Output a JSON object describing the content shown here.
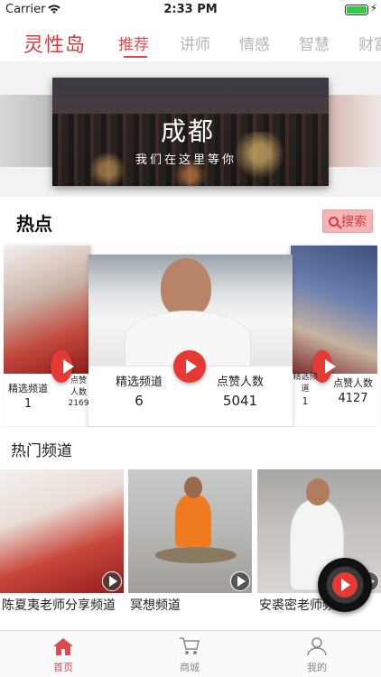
{
  "status_bar": {
    "carrier": "Carrier",
    "time": "2:33 PM"
  },
  "app": {
    "logo": "灵性岛"
  },
  "top_tabs": [
    {
      "label": "推荐",
      "active": true
    },
    {
      "label": "讲师",
      "active": false
    },
    {
      "label": "情感",
      "active": false
    },
    {
      "label": "智慧",
      "active": false
    },
    {
      "label": "财富",
      "active": false
    }
  ],
  "banner": {
    "title": "成都",
    "slogan": "我们在这里等你"
  },
  "hot": {
    "title": "热点",
    "search_label": "搜索",
    "cards": [
      {
        "left_label": "精选频道",
        "left_value": "1",
        "right_label": "点赞人数",
        "right_value": "2169"
      },
      {
        "left_label": "精选频道",
        "left_value": "6",
        "right_label": "点赞人数",
        "right_value": "5041"
      },
      {
        "left_label": "精选频道",
        "left_value": "1",
        "right_label": "点赞人数",
        "right_value": "4127"
      }
    ]
  },
  "channels": {
    "title": "热门频道",
    "items": [
      {
        "label": "陈夏夷老师分享频道"
      },
      {
        "label": "冥想频道"
      },
      {
        "label": "安裘密老师频道"
      }
    ]
  },
  "tab_bar": [
    {
      "label": "首页",
      "active": true
    },
    {
      "label": "商城",
      "active": false
    },
    {
      "label": "我的",
      "active": false
    }
  ],
  "colors": {
    "accent": "#e04a4a",
    "play_red": "#e53935"
  }
}
